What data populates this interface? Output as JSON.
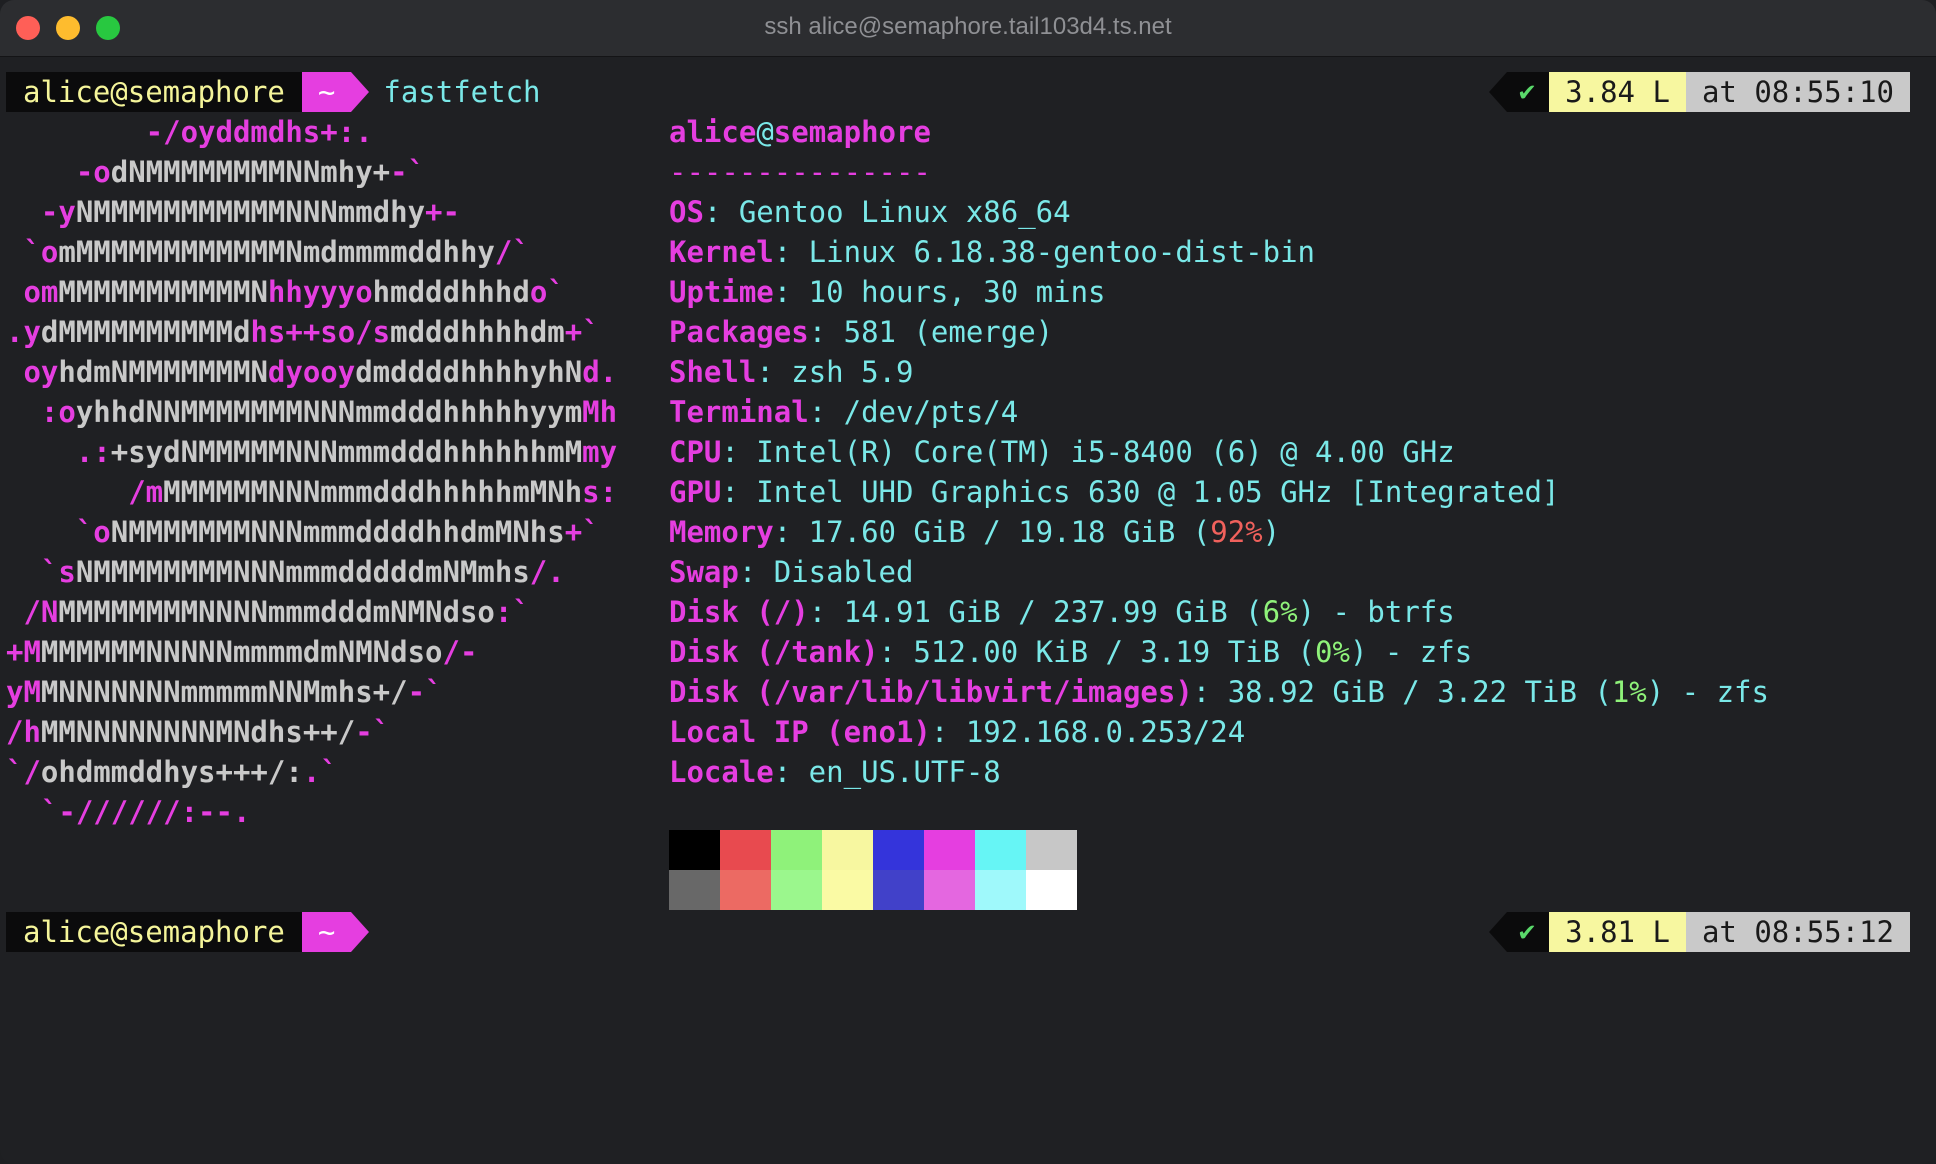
{
  "window": {
    "title": "ssh alice@semaphore.tail103d4.ts.net"
  },
  "prompt1": {
    "user": "alice@semaphore",
    "dir": "~",
    "command": "fastfetch",
    "status_icon": "check-icon",
    "status_glyph": "✔",
    "load": "3.84 L",
    "time": "at 08:55:10"
  },
  "prompt2": {
    "user": "alice@semaphore",
    "dir": "~",
    "command": "",
    "status_icon": "check-icon",
    "status_glyph": "✔",
    "load": "3.81 L",
    "time": "at 08:55:12"
  },
  "logo_lines": [
    [
      [
        "m",
        "        -/oyddmdhs+:."
      ]
    ],
    [
      [
        "m",
        "    -o"
      ],
      [
        "w",
        "dNMMMMMMMMNNmhy+"
      ],
      [
        "m",
        "-`"
      ]
    ],
    [
      [
        "m",
        "  -y"
      ],
      [
        "w",
        "NMMMMMMMMMMMNNNmmdhy"
      ],
      [
        "m",
        "+-"
      ]
    ],
    [
      [
        "m",
        " `o"
      ],
      [
        "w",
        "mMMMMMMMMMMMMNmdmmmmddhhy"
      ],
      [
        "m",
        "/`"
      ]
    ],
    [
      [
        "m",
        " om"
      ],
      [
        "w",
        "MMMMMMMMMMMN"
      ],
      [
        "m",
        "hhyyyo"
      ],
      [
        "w",
        "hmdddhhhd"
      ],
      [
        "m",
        "o`"
      ]
    ],
    [
      [
        "m",
        ".y"
      ],
      [
        "w",
        "dMMMMMMMMMMd"
      ],
      [
        "m",
        "hs++so/s"
      ],
      [
        "w",
        "mdddhhhhdm"
      ],
      [
        "m",
        "+`"
      ]
    ],
    [
      [
        "m",
        " oy"
      ],
      [
        "w",
        "hdmNMMMMMMMN"
      ],
      [
        "m",
        "dyooy"
      ],
      [
        "w",
        "dmddddhhhhyhN"
      ],
      [
        "m",
        "d."
      ]
    ],
    [
      [
        "m",
        "  :o"
      ],
      [
        "w",
        "yhhdNNMMMMMMMNNNmmdddhhhhhyym"
      ],
      [
        "m",
        "Mh"
      ]
    ],
    [
      [
        "m",
        "    .:"
      ],
      [
        "w",
        "+sydNMMMMMNNNmmmdddhhhhhhmM"
      ],
      [
        "m",
        "my"
      ]
    ],
    [
      [
        "m",
        "       /m"
      ],
      [
        "w",
        "MMMMMMNNNmmmdddhhhhhmMNh"
      ],
      [
        "m",
        "s:"
      ]
    ],
    [
      [
        "m",
        "    `o"
      ],
      [
        "w",
        "NMMMMMMMNNNmmmddddhhdmMNhs"
      ],
      [
        "m",
        "+`"
      ]
    ],
    [
      [
        "m",
        "  `s"
      ],
      [
        "w",
        "NMMMMMMMMNNNmmmdddddmNMmhs"
      ],
      [
        "m",
        "/."
      ]
    ],
    [
      [
        "m",
        " /N"
      ],
      [
        "w",
        "MMMMMMMMNNNNmmmdddmNMNdso"
      ],
      [
        "m",
        ":`"
      ]
    ],
    [
      [
        "m",
        "+M"
      ],
      [
        "w",
        "MMMMMMNNNNNmmmmdmNMNdso"
      ],
      [
        "m",
        "/-"
      ]
    ],
    [
      [
        "m",
        "yM"
      ],
      [
        "w",
        "MNNNNNNNmmmmmNNMmhs+/"
      ],
      [
        "m",
        "-`"
      ]
    ],
    [
      [
        "m",
        "/h"
      ],
      [
        "w",
        "MMNNNNNNNNMNdhs++/"
      ],
      [
        "m",
        "-`"
      ]
    ],
    [
      [
        "m",
        "`/"
      ],
      [
        "w",
        "ohdmmddhys+++/:"
      ],
      [
        "m",
        ".`"
      ]
    ],
    [
      [
        "m",
        "  `-//////:--."
      ]
    ]
  ],
  "info": {
    "header_user": "alice",
    "header_at": "@",
    "header_host": "semaphore",
    "separator": "---------------",
    "rows": [
      [
        [
          "k",
          "OS"
        ],
        [
          "v",
          ": Gentoo Linux x86_64"
        ]
      ],
      [
        [
          "k",
          "Kernel"
        ],
        [
          "v",
          ": Linux 6.18.38-gentoo-dist-bin"
        ]
      ],
      [
        [
          "k",
          "Uptime"
        ],
        [
          "v",
          ": 10 hours, 30 mins"
        ]
      ],
      [
        [
          "k",
          "Packages"
        ],
        [
          "v",
          ": 581 (emerge)"
        ]
      ],
      [
        [
          "k",
          "Shell"
        ],
        [
          "v",
          ": zsh 5.9"
        ]
      ],
      [
        [
          "k",
          "Terminal"
        ],
        [
          "v",
          ": /dev/pts/4"
        ]
      ],
      [
        [
          "k",
          "CPU"
        ],
        [
          "v",
          ": Intel(R) Core(TM) i5-8400 (6) @ 4.00 GHz"
        ]
      ],
      [
        [
          "k",
          "GPU"
        ],
        [
          "v",
          ": Intel UHD Graphics 630 @ 1.05 GHz [Integrated]"
        ]
      ],
      [
        [
          "k",
          "Memory"
        ],
        [
          "v",
          ": 17.60 GiB / 19.18 GiB ("
        ],
        [
          "r",
          "92%"
        ],
        [
          "v",
          ")"
        ]
      ],
      [
        [
          "k",
          "Swap"
        ],
        [
          "v",
          ": Disabled"
        ]
      ],
      [
        [
          "k",
          "Disk (/)"
        ],
        [
          "v",
          ": 14.91 GiB / 237.99 GiB ("
        ],
        [
          "g",
          "6%"
        ],
        [
          "v",
          ") - btrfs"
        ]
      ],
      [
        [
          "k",
          "Disk (/tank)"
        ],
        [
          "v",
          ": 512.00 KiB / 3.19 TiB ("
        ],
        [
          "g",
          "0%"
        ],
        [
          "v",
          ") - zfs"
        ]
      ],
      [
        [
          "k",
          "Disk (/var/lib/libvirt/images)"
        ],
        [
          "v",
          ": 38.92 GiB / 3.22 TiB ("
        ],
        [
          "g",
          "1%"
        ],
        [
          "v",
          ") - zfs"
        ]
      ],
      [
        [
          "k",
          "Local IP (eno1)"
        ],
        [
          "v",
          ": 192.168.0.253/24"
        ]
      ],
      [
        [
          "k",
          "Locale"
        ],
        [
          "v",
          ": en_US.UTF-8"
        ]
      ]
    ]
  },
  "palette": {
    "top": [
      "#000000",
      "#e84a4f",
      "#8ff27a",
      "#f7f7a0",
      "#3434db",
      "#e53ee0",
      "#66f5f5",
      "#c7c7c7"
    ],
    "bottom": [
      "#686868",
      "#ec6a63",
      "#9bf78d",
      "#fafaa4",
      "#4141c9",
      "#e467e0",
      "#9ff9fb",
      "#ffffff"
    ]
  }
}
